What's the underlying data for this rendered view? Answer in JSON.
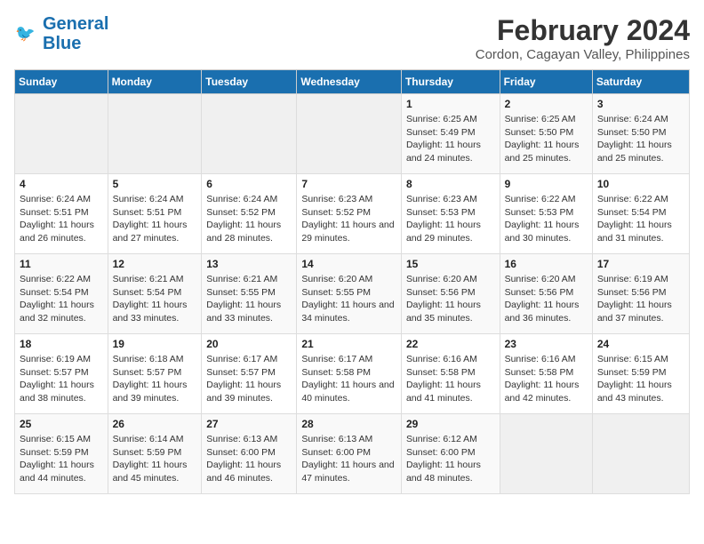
{
  "header": {
    "logo_line1": "General",
    "logo_line2": "Blue",
    "month_year": "February 2024",
    "location": "Cordon, Cagayan Valley, Philippines"
  },
  "days_of_week": [
    "Sunday",
    "Monday",
    "Tuesday",
    "Wednesday",
    "Thursday",
    "Friday",
    "Saturday"
  ],
  "weeks": [
    [
      {
        "day": "",
        "empty": true
      },
      {
        "day": "",
        "empty": true
      },
      {
        "day": "",
        "empty": true
      },
      {
        "day": "",
        "empty": true
      },
      {
        "day": "1",
        "sunrise": "6:25 AM",
        "sunset": "5:49 PM",
        "daylight": "11 hours and 24 minutes."
      },
      {
        "day": "2",
        "sunrise": "6:25 AM",
        "sunset": "5:50 PM",
        "daylight": "11 hours and 25 minutes."
      },
      {
        "day": "3",
        "sunrise": "6:24 AM",
        "sunset": "5:50 PM",
        "daylight": "11 hours and 25 minutes."
      }
    ],
    [
      {
        "day": "4",
        "sunrise": "6:24 AM",
        "sunset": "5:51 PM",
        "daylight": "11 hours and 26 minutes."
      },
      {
        "day": "5",
        "sunrise": "6:24 AM",
        "sunset": "5:51 PM",
        "daylight": "11 hours and 27 minutes."
      },
      {
        "day": "6",
        "sunrise": "6:24 AM",
        "sunset": "5:52 PM",
        "daylight": "11 hours and 28 minutes."
      },
      {
        "day": "7",
        "sunrise": "6:23 AM",
        "sunset": "5:52 PM",
        "daylight": "11 hours and 29 minutes."
      },
      {
        "day": "8",
        "sunrise": "6:23 AM",
        "sunset": "5:53 PM",
        "daylight": "11 hours and 29 minutes."
      },
      {
        "day": "9",
        "sunrise": "6:22 AM",
        "sunset": "5:53 PM",
        "daylight": "11 hours and 30 minutes."
      },
      {
        "day": "10",
        "sunrise": "6:22 AM",
        "sunset": "5:54 PM",
        "daylight": "11 hours and 31 minutes."
      }
    ],
    [
      {
        "day": "11",
        "sunrise": "6:22 AM",
        "sunset": "5:54 PM",
        "daylight": "11 hours and 32 minutes."
      },
      {
        "day": "12",
        "sunrise": "6:21 AM",
        "sunset": "5:54 PM",
        "daylight": "11 hours and 33 minutes."
      },
      {
        "day": "13",
        "sunrise": "6:21 AM",
        "sunset": "5:55 PM",
        "daylight": "11 hours and 33 minutes."
      },
      {
        "day": "14",
        "sunrise": "6:20 AM",
        "sunset": "5:55 PM",
        "daylight": "11 hours and 34 minutes."
      },
      {
        "day": "15",
        "sunrise": "6:20 AM",
        "sunset": "5:56 PM",
        "daylight": "11 hours and 35 minutes."
      },
      {
        "day": "16",
        "sunrise": "6:20 AM",
        "sunset": "5:56 PM",
        "daylight": "11 hours and 36 minutes."
      },
      {
        "day": "17",
        "sunrise": "6:19 AM",
        "sunset": "5:56 PM",
        "daylight": "11 hours and 37 minutes."
      }
    ],
    [
      {
        "day": "18",
        "sunrise": "6:19 AM",
        "sunset": "5:57 PM",
        "daylight": "11 hours and 38 minutes."
      },
      {
        "day": "19",
        "sunrise": "6:18 AM",
        "sunset": "5:57 PM",
        "daylight": "11 hours and 39 minutes."
      },
      {
        "day": "20",
        "sunrise": "6:17 AM",
        "sunset": "5:57 PM",
        "daylight": "11 hours and 39 minutes."
      },
      {
        "day": "21",
        "sunrise": "6:17 AM",
        "sunset": "5:58 PM",
        "daylight": "11 hours and 40 minutes."
      },
      {
        "day": "22",
        "sunrise": "6:16 AM",
        "sunset": "5:58 PM",
        "daylight": "11 hours and 41 minutes."
      },
      {
        "day": "23",
        "sunrise": "6:16 AM",
        "sunset": "5:58 PM",
        "daylight": "11 hours and 42 minutes."
      },
      {
        "day": "24",
        "sunrise": "6:15 AM",
        "sunset": "5:59 PM",
        "daylight": "11 hours and 43 minutes."
      }
    ],
    [
      {
        "day": "25",
        "sunrise": "6:15 AM",
        "sunset": "5:59 PM",
        "daylight": "11 hours and 44 minutes."
      },
      {
        "day": "26",
        "sunrise": "6:14 AM",
        "sunset": "5:59 PM",
        "daylight": "11 hours and 45 minutes."
      },
      {
        "day": "27",
        "sunrise": "6:13 AM",
        "sunset": "6:00 PM",
        "daylight": "11 hours and 46 minutes."
      },
      {
        "day": "28",
        "sunrise": "6:13 AM",
        "sunset": "6:00 PM",
        "daylight": "11 hours and 47 minutes."
      },
      {
        "day": "29",
        "sunrise": "6:12 AM",
        "sunset": "6:00 PM",
        "daylight": "11 hours and 48 minutes."
      },
      {
        "day": "",
        "empty": true
      },
      {
        "day": "",
        "empty": true
      }
    ]
  ],
  "labels": {
    "sunrise_prefix": "Sunrise: ",
    "sunset_prefix": "Sunset: ",
    "daylight_prefix": "Daylight: "
  }
}
